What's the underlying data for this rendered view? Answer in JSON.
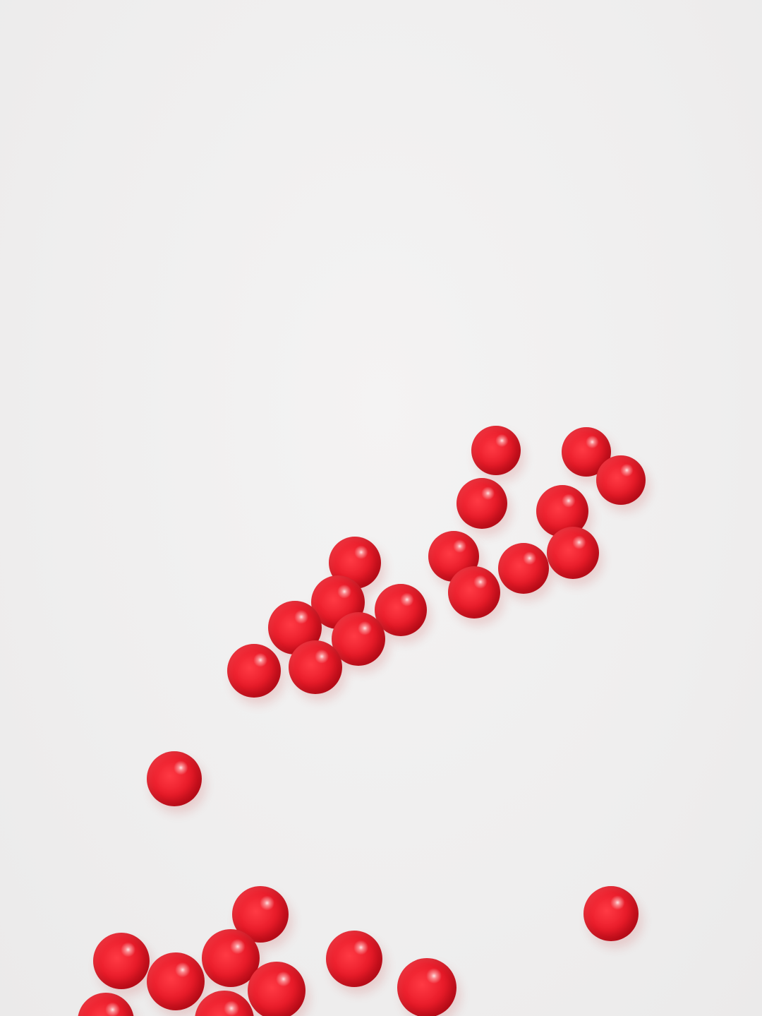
{
  "image": {
    "subject": "red gel beads",
    "background_color": "#f0efef",
    "bead_color": "#e61a28"
  }
}
